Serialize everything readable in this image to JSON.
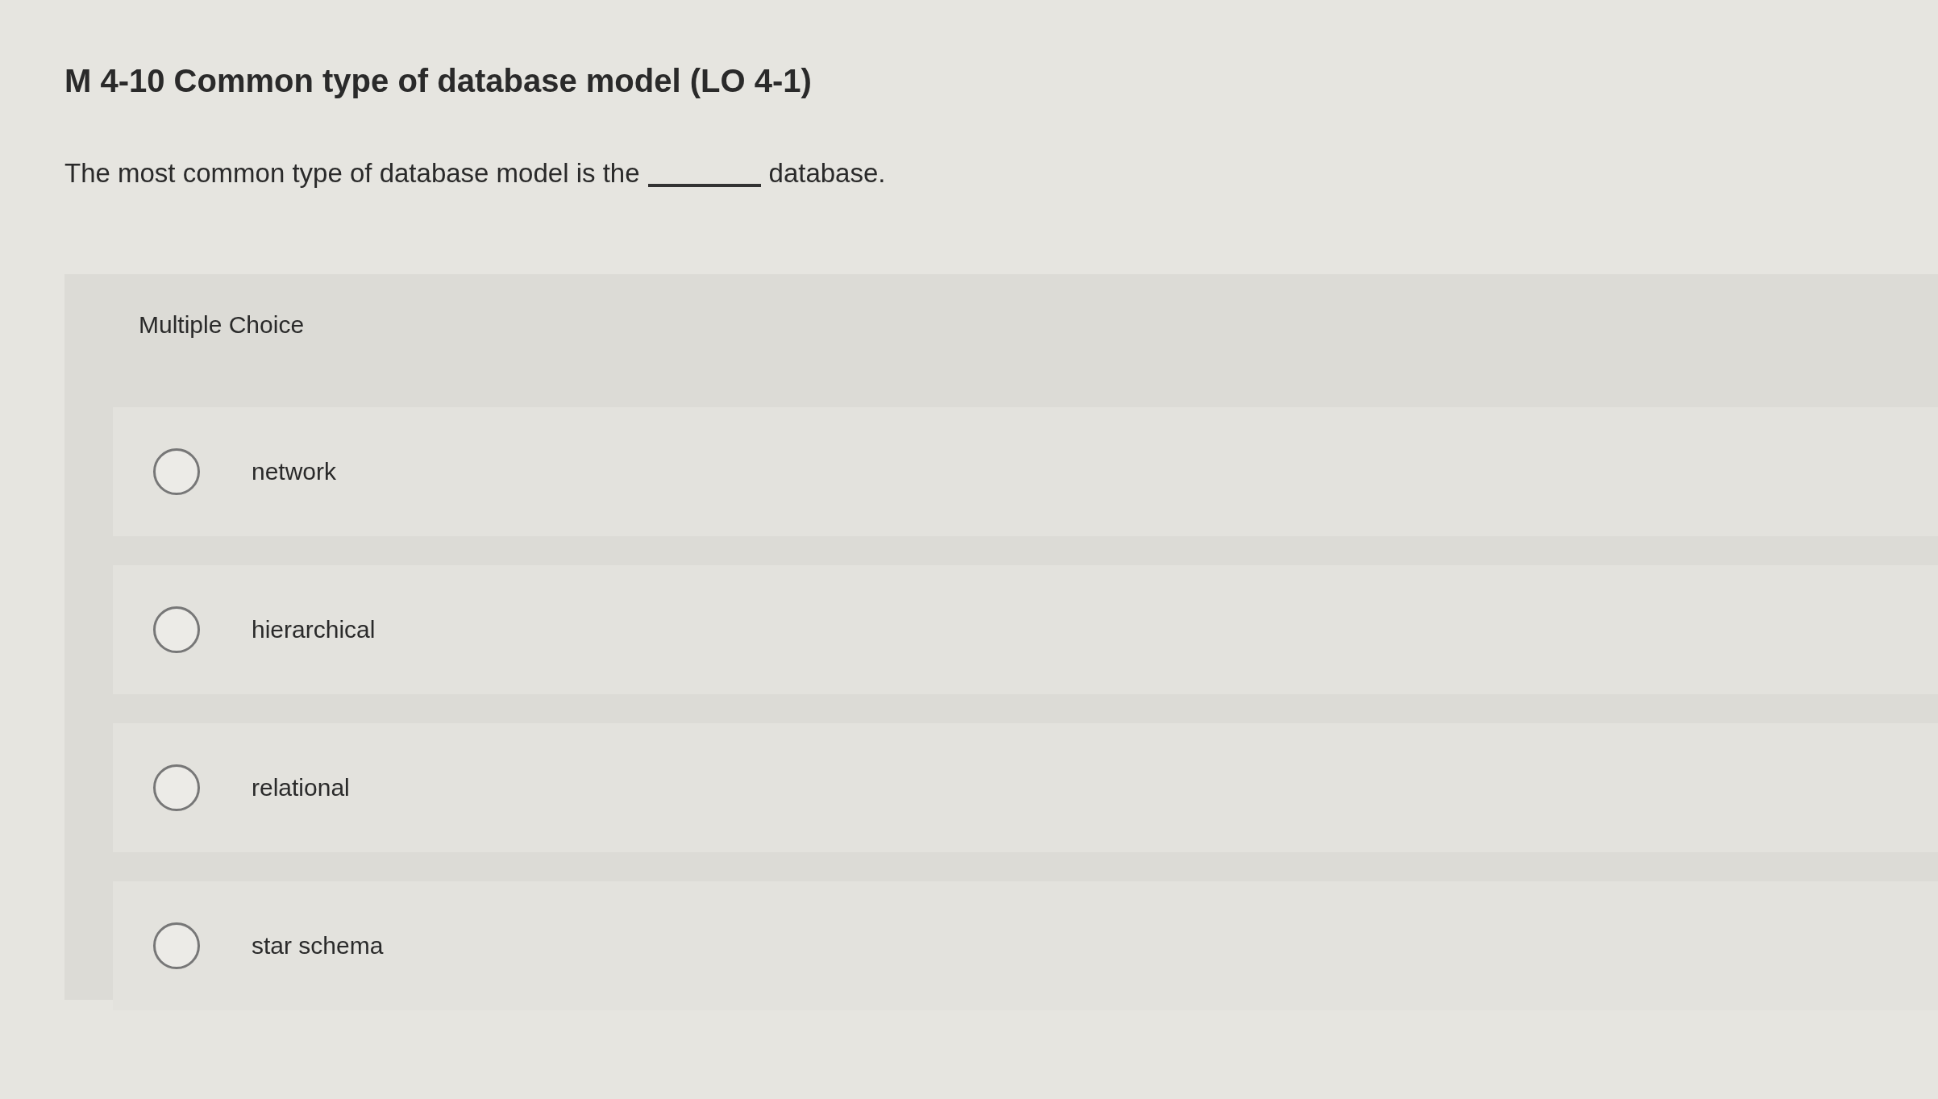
{
  "question": {
    "title": "M 4-10 Common type of database model (LO 4-1)",
    "text_before": "The most common type of database model is the",
    "text_after": "database."
  },
  "panel": {
    "heading": "Multiple Choice",
    "options": [
      {
        "label": "network",
        "selected": false
      },
      {
        "label": "hierarchical",
        "selected": false
      },
      {
        "label": "relational",
        "selected": false
      },
      {
        "label": "star schema",
        "selected": false
      }
    ]
  }
}
